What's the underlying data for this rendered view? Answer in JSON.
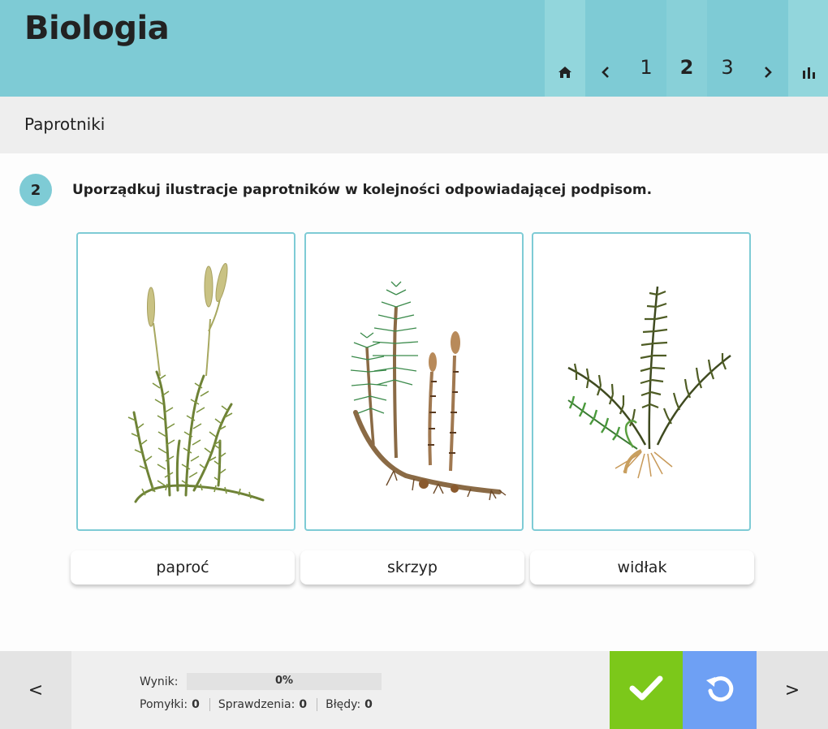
{
  "header": {
    "title": "Biologia",
    "nav": {
      "home_icon": "home-icon",
      "prev_icon": "chevron-left-icon",
      "pages": [
        "1",
        "2",
        "3"
      ],
      "active_page": "2",
      "next_icon": "chevron-right-icon",
      "stats_icon": "bar-chart-icon"
    }
  },
  "section": {
    "title": "Paprotniki"
  },
  "question": {
    "number": "2",
    "text": "Uporządkuj ilustracje paprotników w kolejności odpowiadającej podpisom.",
    "images": [
      {
        "icon": "clubmoss-illustration"
      },
      {
        "icon": "horsetail-illustration"
      },
      {
        "icon": "fern-illustration"
      }
    ],
    "labels": [
      "paproć",
      "skrzyp",
      "widłak"
    ]
  },
  "footer": {
    "prev": "<",
    "next": ">",
    "result_label": "Wynik:",
    "result_value": "0%",
    "result_fraction": 0,
    "mistakes_label": "Pomyłki:",
    "mistakes_value": "0",
    "checks_label": "Sprawdzenia:",
    "checks_value": "0",
    "errors_label": "Błędy:",
    "errors_value": "0",
    "check_icon": "checkmark-icon",
    "reset_icon": "reset-icon"
  },
  "colors": {
    "accent": "#7ecbd5",
    "check": "#7cc81a",
    "reset": "#6ea0f4"
  }
}
